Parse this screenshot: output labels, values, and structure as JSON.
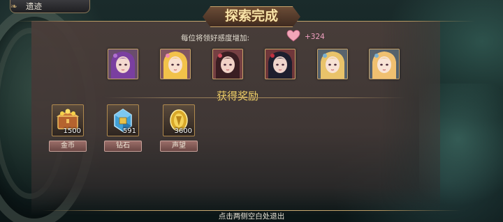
{
  "location_tab": {
    "label": "遗迹"
  },
  "title": "探索完成",
  "affinity": {
    "label": "每位将领好感度增加:",
    "value": "+324",
    "icon": "heart-icon",
    "icon_color": "#f2a6b8"
  },
  "portraits": [
    {
      "name": "portrait-1",
      "hair": "#7a3fa0",
      "skin": "#f3d9cf",
      "accent": "#b070d0"
    },
    {
      "name": "portrait-2",
      "hair": "#f2c24a",
      "skin": "#f8e0d0",
      "accent": "#f08ab0"
    },
    {
      "name": "portrait-3",
      "hair": "#3a1e22",
      "skin": "#f1d2c6",
      "accent": "#d04a5a"
    },
    {
      "name": "portrait-4",
      "hair": "#1e1e2e",
      "skin": "#f0d4cc",
      "accent": "#c03040"
    },
    {
      "name": "portrait-5",
      "hair": "#e9c36a",
      "skin": "#f7e2d4",
      "accent": "#7ab0d0"
    },
    {
      "name": "portrait-6",
      "hair": "#f0c070",
      "skin": "#f8e4d6",
      "accent": "#7ab0d0"
    }
  ],
  "rewards_title": "获得奖励",
  "rewards": [
    {
      "label": "金币",
      "count": "1500",
      "icon": "treasure-chest-icon"
    },
    {
      "label": "钻石",
      "count": "591",
      "icon": "diamond-icon"
    },
    {
      "label": "声望",
      "count": "3600",
      "icon": "prestige-medal-icon"
    }
  ],
  "exit_hint": "点击两侧空白处退出",
  "colors": {
    "title": "#f7e3a8",
    "rewards_title": "#f0d066",
    "gold_trim": "#c9a46a"
  }
}
